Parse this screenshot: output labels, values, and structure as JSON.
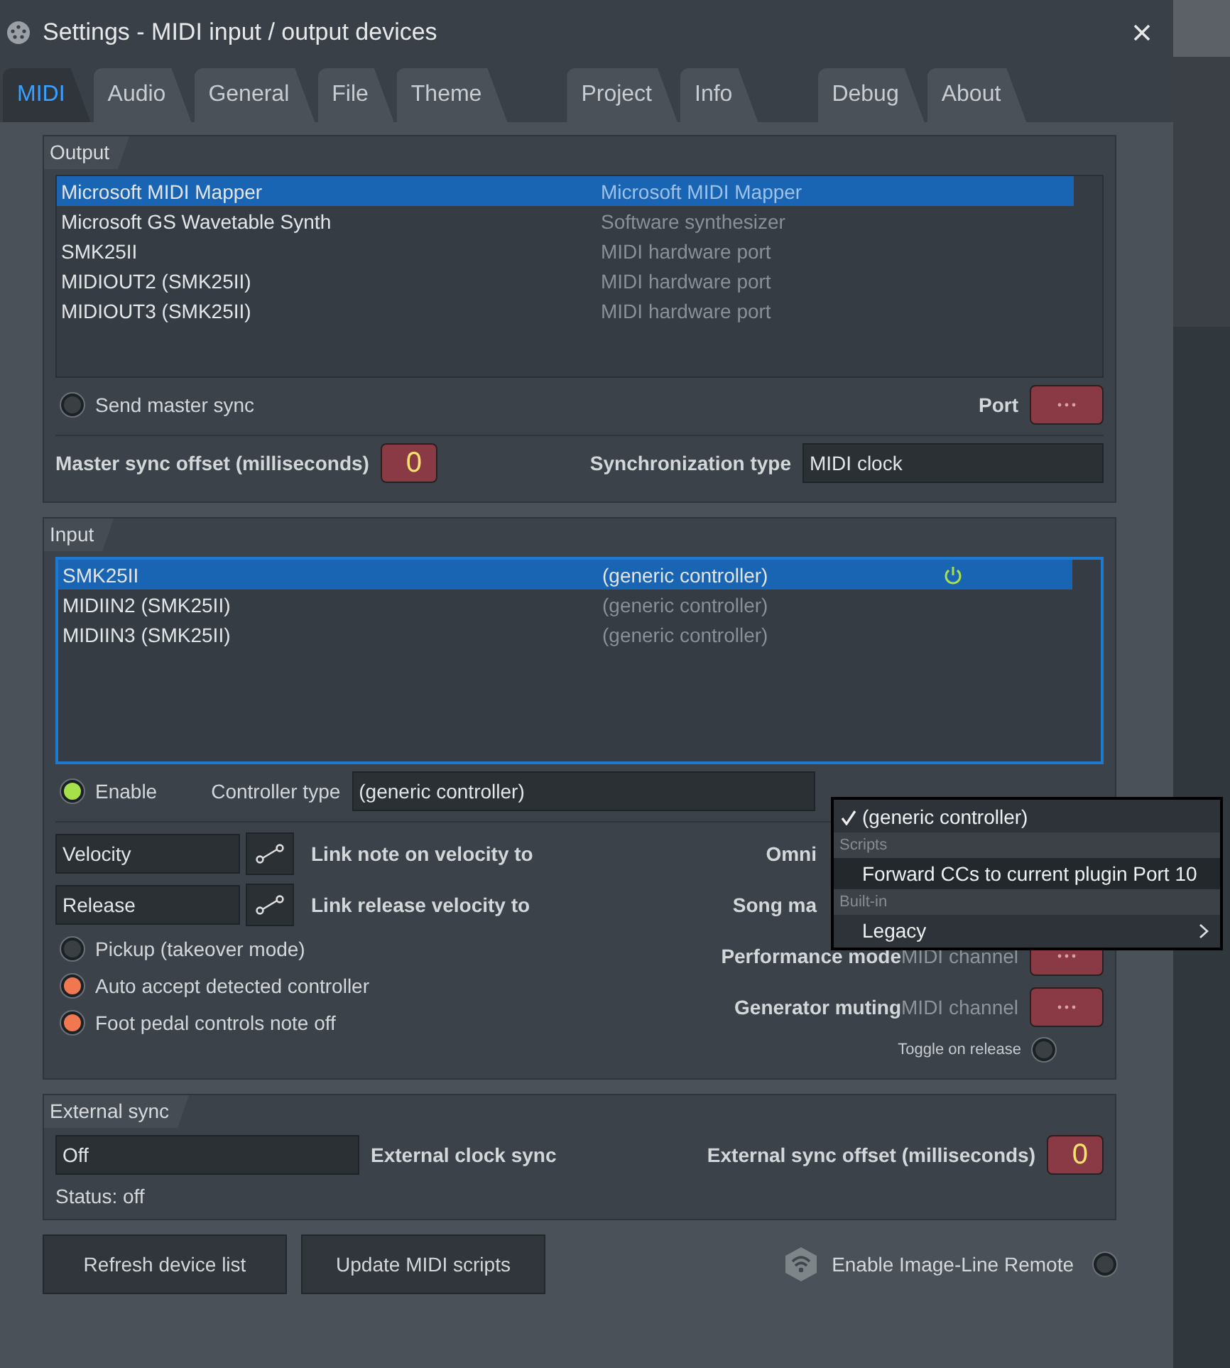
{
  "window": {
    "title": "Settings - MIDI input / output devices"
  },
  "tabs": [
    {
      "label": "MIDI",
      "selected": true
    },
    {
      "label": "Audio",
      "selected": false
    },
    {
      "label": "General",
      "selected": false
    },
    {
      "label": "File",
      "selected": false
    },
    {
      "label": "Theme",
      "selected": false
    },
    {
      "label": "Project",
      "selected": false
    },
    {
      "label": "Info",
      "selected": false
    },
    {
      "label": "Debug",
      "selected": false
    },
    {
      "label": "About",
      "selected": false
    }
  ],
  "output": {
    "title": "Output",
    "devices": [
      {
        "name": "Microsoft MIDI Mapper",
        "description": "Microsoft MIDI Mapper",
        "selected": true
      },
      {
        "name": "Microsoft GS Wavetable Synth",
        "description": "Software synthesizer",
        "selected": false
      },
      {
        "name": "SMK25II",
        "description": "MIDI hardware port",
        "selected": false
      },
      {
        "name": "MIDIOUT2 (SMK25II)",
        "description": "MIDI hardware port",
        "selected": false
      },
      {
        "name": "MIDIOUT3 (SMK25II)",
        "description": "MIDI hardware port",
        "selected": false
      }
    ],
    "send_master_sync": {
      "label": "Send master sync",
      "checked": false
    },
    "port_label": "Port",
    "offset_label": "Master sync offset (milliseconds)",
    "offset_value": "0",
    "sync_type_label": "Synchronization type",
    "sync_type_value": "MIDI clock"
  },
  "input": {
    "title": "Input",
    "devices": [
      {
        "name": "SMK25II",
        "controller": "(generic controller)",
        "selected": true,
        "active": true
      },
      {
        "name": "MIDIIN2 (SMK25II)",
        "controller": "(generic controller)",
        "selected": false,
        "active": false
      },
      {
        "name": "MIDIIN3 (SMK25II)",
        "controller": "(generic controller)",
        "selected": false,
        "active": false
      }
    ],
    "enable": {
      "label": "Enable",
      "checked": true
    },
    "controller_type_label": "Controller type",
    "controller_type_value": "(generic controller)",
    "links": [
      {
        "value": "Velocity",
        "label": "Link note on velocity to"
      },
      {
        "value": "Release",
        "label": "Link release velocity to"
      }
    ],
    "options": [
      {
        "label": "Pickup (takeover mode)",
        "checked": false
      },
      {
        "label": "Auto accept detected controller",
        "checked": true
      },
      {
        "label": "Foot pedal controls note off",
        "checked": true
      }
    ],
    "channels": [
      {
        "label": "Omni",
        "covered": true
      },
      {
        "label": "Song ma",
        "covered": true
      },
      {
        "label": "Performance mode",
        "suffix": "MIDI channel"
      },
      {
        "label": "Generator muting",
        "suffix": "MIDI channel"
      }
    ],
    "toggle_on_release": {
      "label": "Toggle on release",
      "checked": false
    }
  },
  "controller_menu": [
    {
      "kind": "item",
      "label": "(generic controller)",
      "checked": true,
      "selected": false
    },
    {
      "kind": "header",
      "label": "Scripts"
    },
    {
      "kind": "item",
      "label": "Forward CCs to current plugin Port 10",
      "checked": false,
      "selected": true
    },
    {
      "kind": "header",
      "label": "Built-in"
    },
    {
      "kind": "submenu",
      "label": "Legacy",
      "checked": false,
      "selected": false
    }
  ],
  "external_sync": {
    "title": "External sync",
    "clock_value": "Off",
    "clock_label": "External clock sync",
    "offset_label": "External sync offset (milliseconds)",
    "offset_value": "0",
    "status": "Status: off"
  },
  "buttons": [
    "Refresh device list",
    "Update MIDI scripts"
  ],
  "remote": {
    "label": "Enable Image-Line Remote",
    "checked": false
  }
}
